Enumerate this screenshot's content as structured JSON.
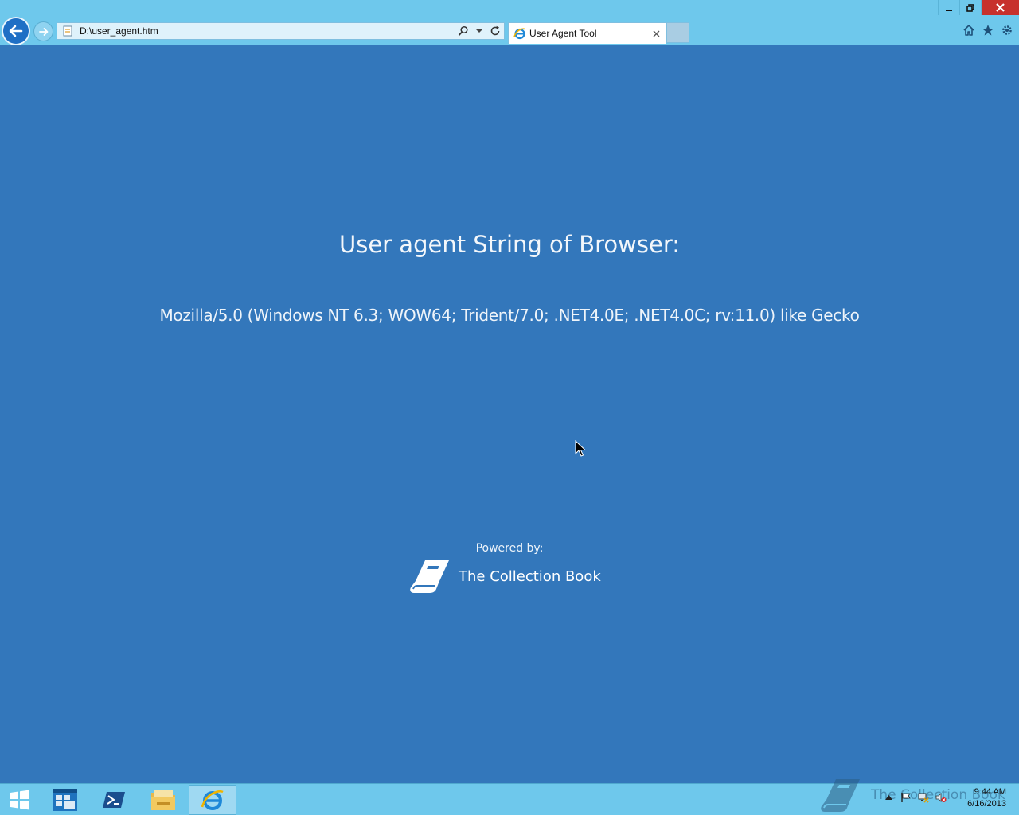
{
  "browser": {
    "address_url": "D:\\user_agent.htm",
    "tab_title": "User Agent Tool",
    "icons": {
      "back": "back-arrow-icon",
      "forward": "forward-arrow-icon",
      "search": "search-icon",
      "refresh": "refresh-icon",
      "home": "home-icon",
      "favorites": "star-icon",
      "tools": "gear-icon"
    }
  },
  "page": {
    "heading": "User agent String of Browser:",
    "user_agent": "Mozilla/5.0 (Windows NT 6.3; WOW64; Trident/7.0; .NET4.0E; .NET4.0C; rv:11.0) like Gecko",
    "powered_by": "Powered by:",
    "brand": "The Collection Book"
  },
  "taskbar": {
    "items": [
      "start-button",
      "server-manager",
      "powershell",
      "file-explorer",
      "internet-explorer"
    ],
    "watermark": "The Collection Book",
    "clock_time": "9:44 AM",
    "clock_date": "6/16/2013"
  },
  "colors": {
    "page_background": "#3377bb",
    "chrome_background": "#6ec8ec",
    "close_button": "#c7312c"
  }
}
